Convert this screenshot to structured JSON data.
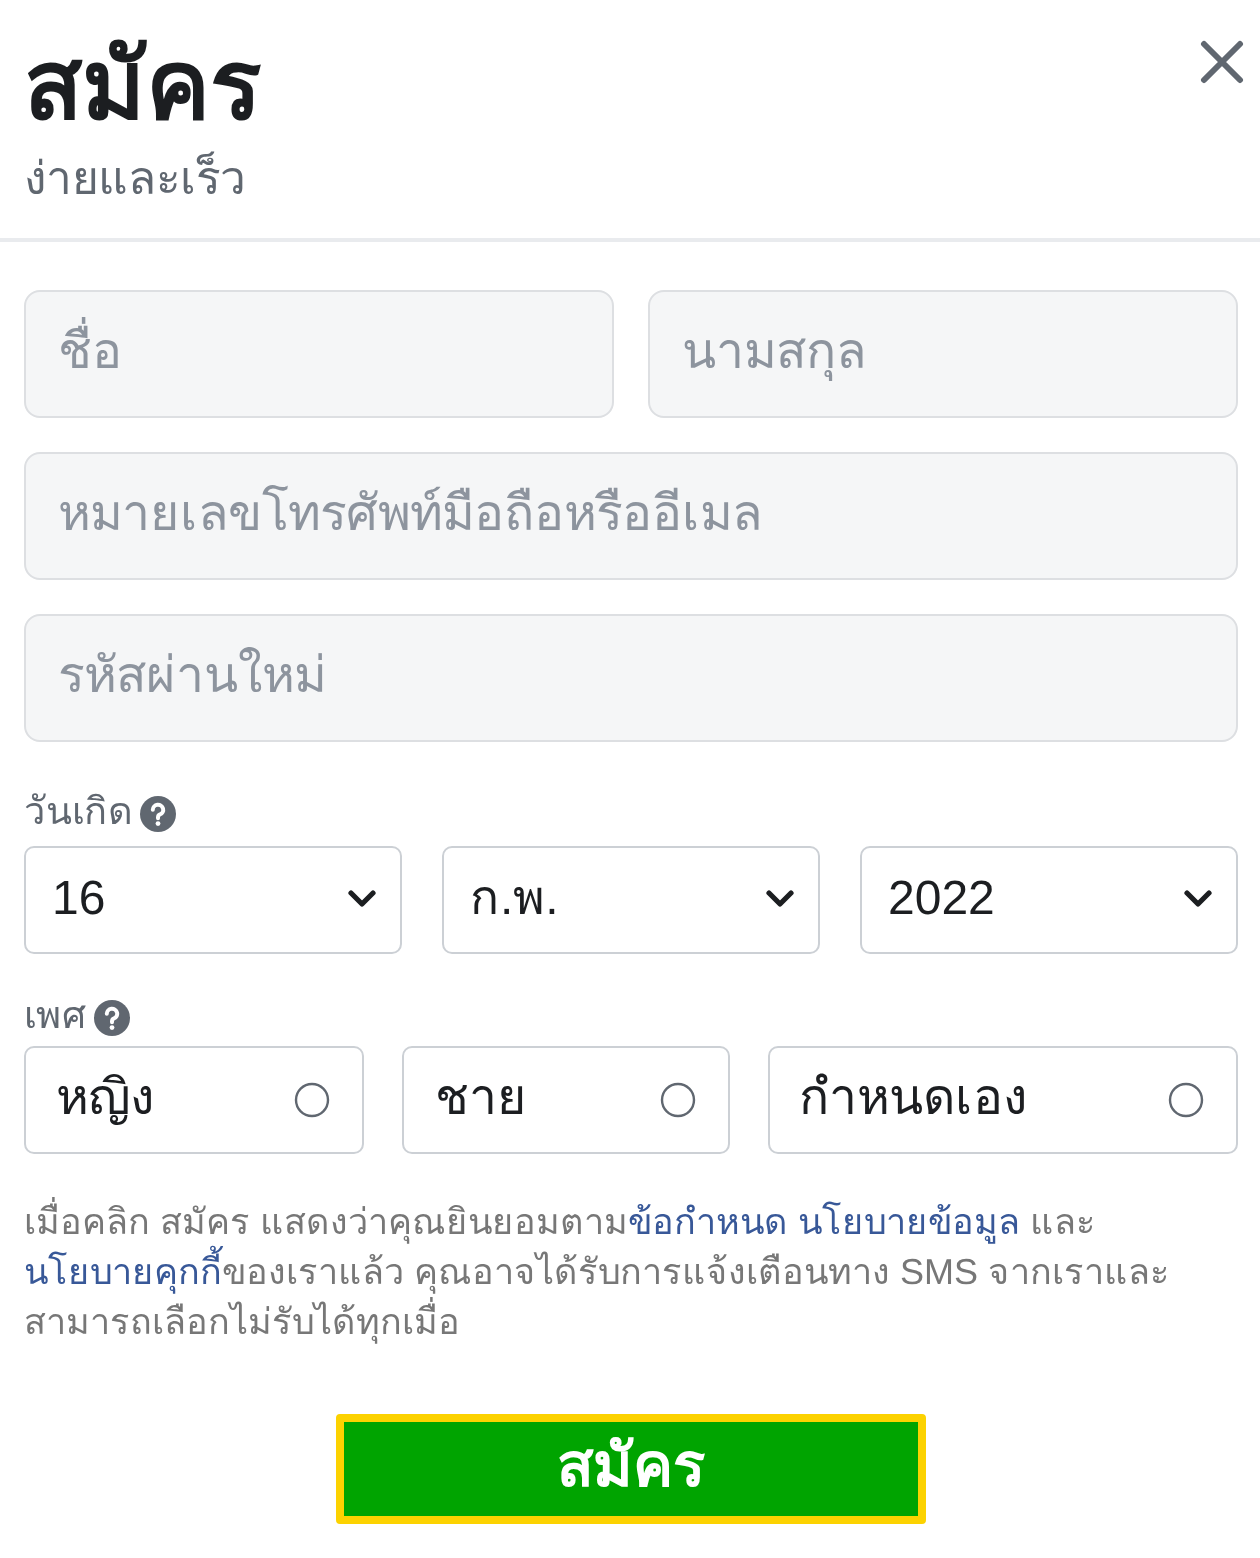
{
  "dialog": {
    "title": "สมัคร",
    "subtitle": "ง่ายและเร็ว"
  },
  "name_fields": [
    {
      "placeholder": "ชื่อ"
    },
    {
      "placeholder": "นามสกุล"
    }
  ],
  "contact_field": {
    "placeholder": "หมายเลขโทรศัพท์มือถือหรืออีเมล"
  },
  "password_field": {
    "placeholder": "รหัสผ่านใหม่"
  },
  "birthday": {
    "label": "วันเกิด",
    "selects": [
      {
        "value": "16"
      },
      {
        "value": "ก.พ."
      },
      {
        "value": "2022"
      }
    ]
  },
  "gender": {
    "label": "เพศ",
    "options": [
      {
        "label": "หญิง",
        "selected": false
      },
      {
        "label": "ชาย",
        "selected": false
      },
      {
        "label": "กำหนดเอง",
        "selected": false
      }
    ]
  },
  "terms": [
    {
      "kind": "text",
      "text": "เมื่อคลิก สมัคร แสดงว่าคุณยินยอมตาม"
    },
    {
      "kind": "link",
      "text": "ข้อกำหนด"
    },
    {
      "kind": "link",
      "text": "นโยบายข้อมูล"
    },
    {
      "kind": "text",
      "text": " และ "
    },
    {
      "kind": "link",
      "text": "นโยบายคุกกี้"
    },
    {
      "kind": "text",
      "text": "ของเราแล้ว คุณอาจได้รับการแจ้งเตือนทาง SMS จากเราและสามารถเลือกไม่รับได้ทุกเมื่อ"
    }
  ],
  "submit_button": {
    "label": "สมัคร",
    "focused": true
  }
}
